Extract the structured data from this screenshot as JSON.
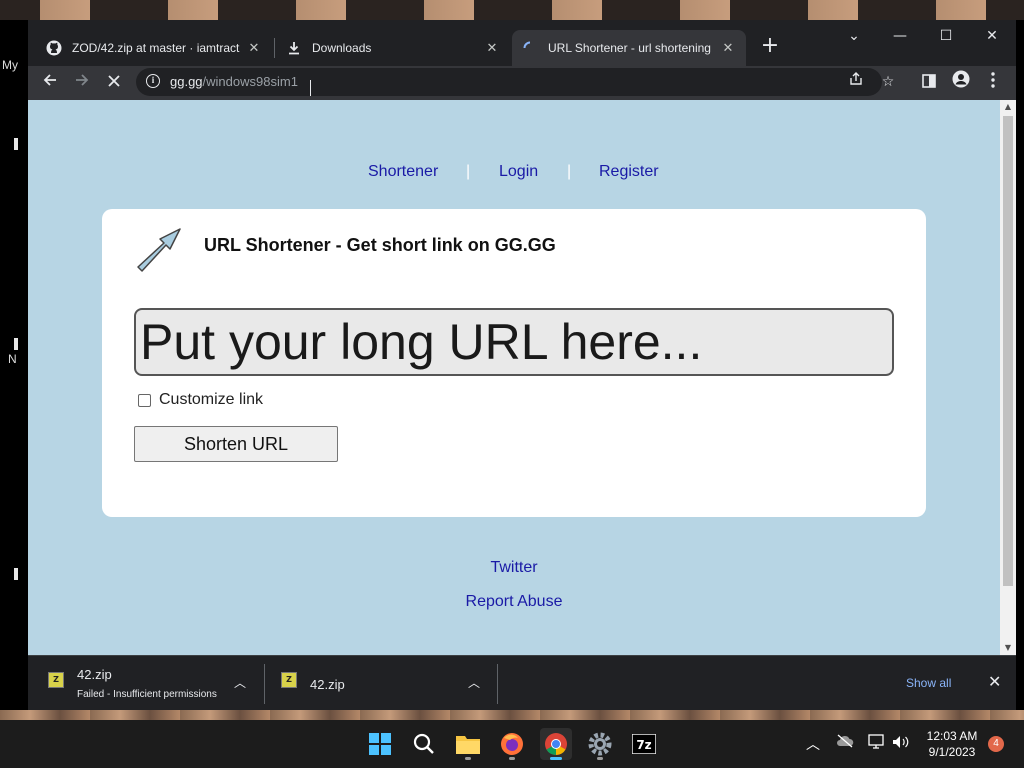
{
  "desktop": {
    "left_labels": [
      "My",
      "N"
    ]
  },
  "browser": {
    "tabs": [
      {
        "title": "ZOD/42.zip at master · iamtraction",
        "icon": "github-icon"
      },
      {
        "title": "Downloads",
        "icon": "download-icon"
      },
      {
        "title": "URL Shortener - url shortening service",
        "icon": "loading-spinner-icon",
        "active": true
      }
    ],
    "address": {
      "host": "gg.gg",
      "path": "/windows98sim1"
    }
  },
  "page": {
    "nav": {
      "shortener": "Shortener",
      "login": "Login",
      "register": "Register",
      "separator": "|"
    },
    "title": "URL Shortener - Get short link on GG.GG",
    "url_input_placeholder": "Put your long URL here...",
    "customize_label": "Customize link",
    "shorten_button": "Shorten URL",
    "footer": {
      "twitter": "Twitter",
      "report_abuse": "Report Abuse"
    }
  },
  "downloads": {
    "items": [
      {
        "name": "42.zip",
        "status": "Failed - Insufficient permissions"
      },
      {
        "name": "42.zip",
        "status": ""
      }
    ],
    "show_all": "Show all"
  },
  "taskbar": {
    "apps": [
      "windows-start-icon",
      "search-icon",
      "file-explorer-icon",
      "firefox-icon",
      "chrome-icon",
      "settings-icon",
      "7zip-icon"
    ],
    "time": "12:03 AM",
    "date": "9/1/2023",
    "notifications": "4"
  }
}
